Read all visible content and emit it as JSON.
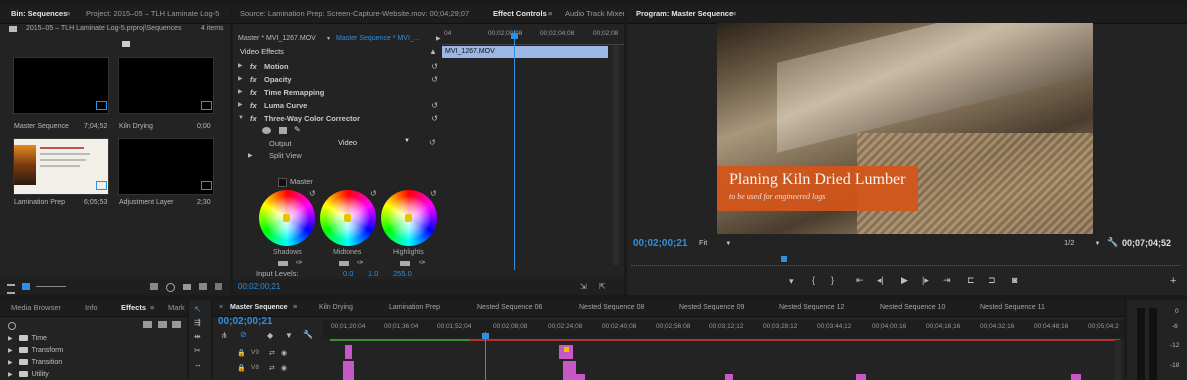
{
  "bin": {
    "tab1": "Bin: Sequences",
    "tab1_menu": "≡",
    "tab2": "Project: 2015–05 – TLH Laminate Log-5",
    "path": "2015–05 – TLH Laminate Log-5.prproj\\Sequences",
    "count": "4 items",
    "items": [
      {
        "name": "Master Sequence",
        "duration": "7;04;52"
      },
      {
        "name": "Kiln Drying",
        "duration": "0;00"
      },
      {
        "name": "Lamination Prep",
        "duration": "6;05;53"
      },
      {
        "name": "Adjustment Layer",
        "duration": "2;30"
      }
    ]
  },
  "effect_controls": {
    "tab_source": "Source: Lamination Prep: Screen-Capture-Website.mov: 00;04;29;07",
    "tab_effects": "Effect Controls",
    "tab_effects_menu": "≡",
    "tab_audio": "Audio Track Mixer",
    "master_label": "Master * MVI_1267.MOV",
    "sequence_label": "Master Sequence * MVI_...",
    "ruler": [
      "04",
      "00;02;00;08",
      "00;02;04;08",
      "00;02;08"
    ],
    "clip_name": "MVI_1267.MOV",
    "video_effects": "Video Effects",
    "effects": [
      "Motion",
      "Opacity",
      "Time Remapping",
      "Luma Curve",
      "Three-Way Color Corrector"
    ],
    "output_label": "Output",
    "output_value": "Video",
    "split_view": "Split View",
    "master_checkbox": "Master",
    "wheels": [
      "Shadows",
      "Midtones",
      "Highlights"
    ],
    "input_levels_label": "Input Levels:",
    "input_levels": [
      "0.0",
      "1.0",
      "255.0"
    ],
    "timecode": "00;02;00;21"
  },
  "program": {
    "tab": "Program: Master Sequence",
    "tab_menu": "≡",
    "title": "Planing Kiln Dried Lumber",
    "subtitle": "to be used for engineered logs",
    "timecode": "00;02;00;21",
    "fit": "Fit",
    "resolution": "1/2",
    "duration": "00;07;04;52"
  },
  "effects_panel": {
    "tabs": [
      "Media Browser",
      "Info",
      "Effects",
      "Mark"
    ],
    "effects_menu": "≡",
    "folders": [
      "Time",
      "Transform",
      "Transition",
      "Utility"
    ]
  },
  "timeline": {
    "sequence_tabs": [
      "Master Sequence",
      "Kiln Drying",
      "Lamination Prep",
      "Nested Sequence 06",
      "Nested Sequence 08",
      "Nested Sequence 09",
      "Nested Sequence 12",
      "Nested Sequence 10",
      "Nested Sequence 11"
    ],
    "close_glyph": "×",
    "tab_menu": "≡",
    "timecode": "00;02;00;21",
    "ruler": [
      "00;01;20;04",
      "00;01;36;04",
      "00;01;52;04",
      "00;02;08;08",
      "00;02;24;08",
      "00;02;40;08",
      "00;02;56;08",
      "00;03;12;12",
      "00;03;28;12",
      "00;03;44;12",
      "00;04;00;16",
      "00;04;16;16",
      "00;04;32;16",
      "00;04;48;16",
      "00;05;04;2"
    ],
    "tracks": [
      "V9",
      "V8"
    ]
  },
  "meter": {
    "labels": [
      "0",
      "-6",
      "-12",
      "-18"
    ]
  },
  "colors": {
    "accent": "#2f8fe0",
    "lower_third": "#d4561a",
    "clip": "#c658c8"
  }
}
